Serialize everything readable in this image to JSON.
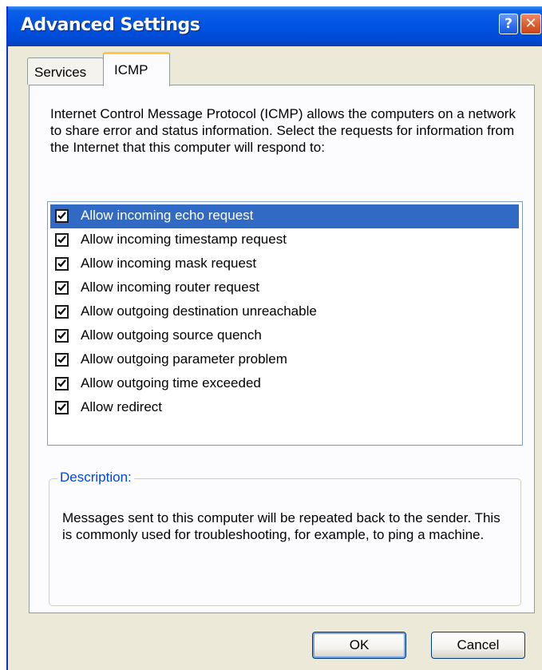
{
  "window": {
    "title": "Advanced Settings",
    "help_glyph": "?",
    "close_glyph": "✕"
  },
  "tabs": [
    {
      "label": "Services",
      "selected": false
    },
    {
      "label": "ICMP",
      "selected": true
    }
  ],
  "icmp": {
    "intro": "Internet Control Message Protocol (ICMP) allows the computers on a network to share error and status information. Select the requests for information from the Internet that this computer will respond to:",
    "items": [
      {
        "label": "Allow incoming echo request",
        "checked": true,
        "selected": true
      },
      {
        "label": "Allow incoming timestamp request",
        "checked": true,
        "selected": false
      },
      {
        "label": "Allow incoming mask request",
        "checked": true,
        "selected": false
      },
      {
        "label": "Allow incoming router request",
        "checked": true,
        "selected": false
      },
      {
        "label": "Allow outgoing destination unreachable",
        "checked": true,
        "selected": false
      },
      {
        "label": "Allow outgoing source quench",
        "checked": true,
        "selected": false
      },
      {
        "label": "Allow outgoing parameter problem",
        "checked": true,
        "selected": false
      },
      {
        "label": "Allow outgoing time exceeded",
        "checked": true,
        "selected": false
      },
      {
        "label": "Allow redirect",
        "checked": true,
        "selected": false
      }
    ],
    "description": {
      "title": "Description:",
      "text": "Messages sent to this computer will be repeated back to the sender. This is commonly used for troubleshooting, for example, to ping a machine."
    }
  },
  "buttons": {
    "ok": "OK",
    "cancel": "Cancel"
  },
  "colors": {
    "titlebar": "#0054e3",
    "selection": "#316ac5",
    "dialog_face": "#ece9d8",
    "group_title": "#0046d5"
  }
}
